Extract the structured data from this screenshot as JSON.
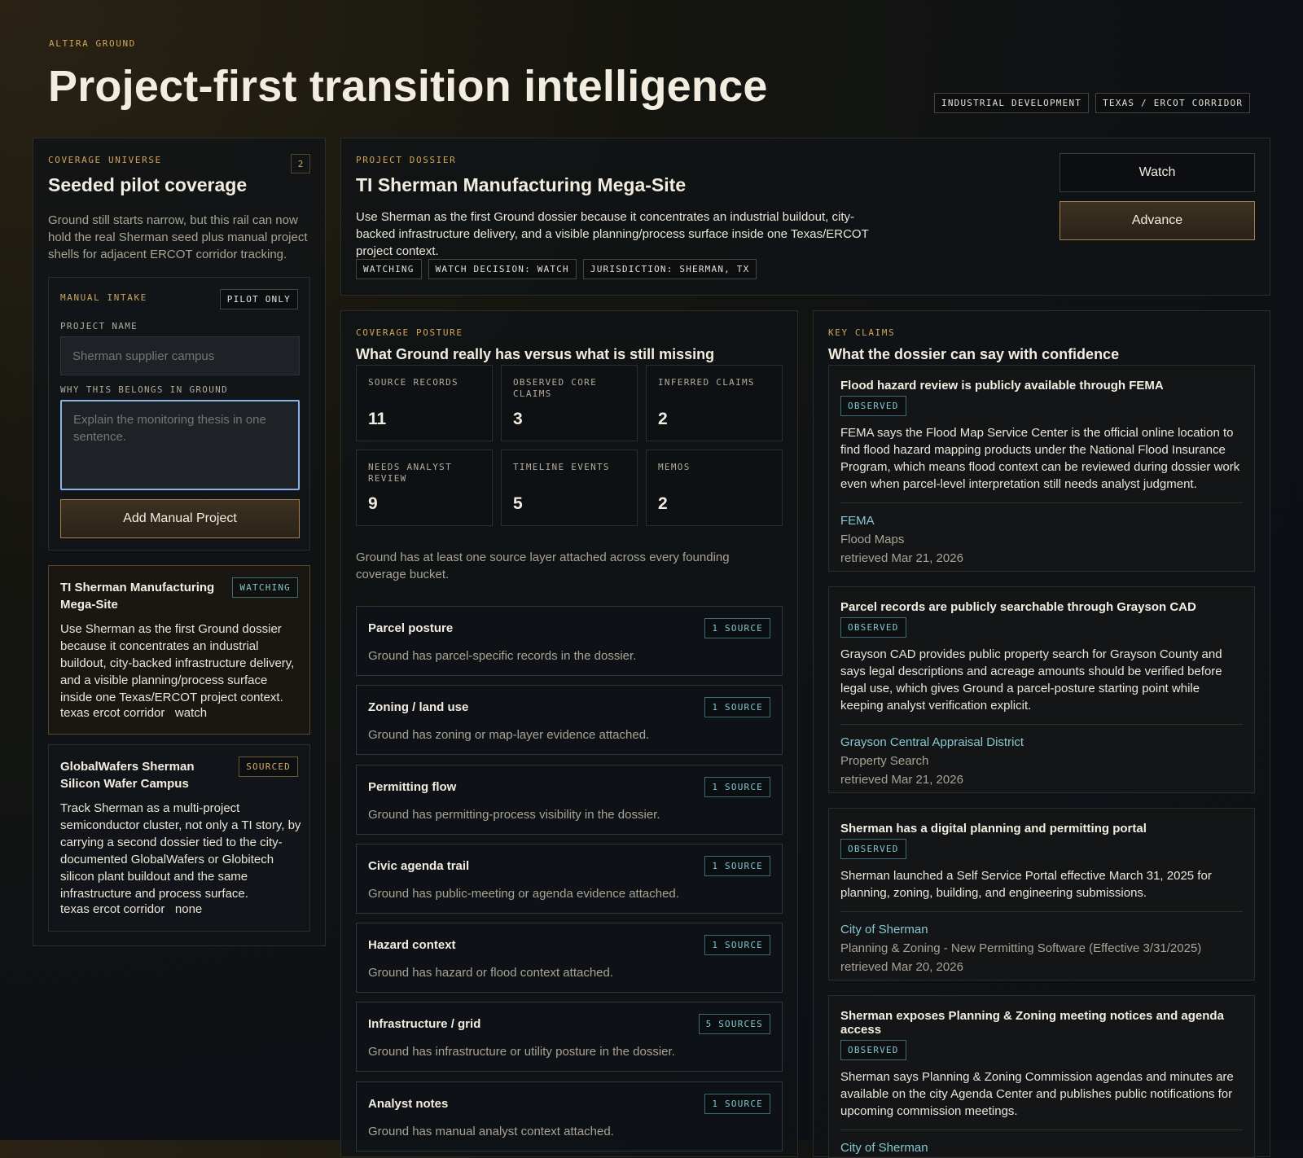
{
  "header": {
    "eyebrow": "ALTIRA GROUND",
    "title": "Project-first transition intelligence",
    "tags": [
      "INDUSTRIAL DEVELOPMENT",
      "TEXAS / ERCOT CORRIDOR"
    ]
  },
  "coverage": {
    "eyebrow": "COVERAGE UNIVERSE",
    "count": "2",
    "title": "Seeded pilot coverage",
    "description": "Ground still starts narrow, but this rail can now hold the real Sherman seed plus manual project shells for adjacent ERCOT corridor tracking.",
    "intake": {
      "eyebrow": "MANUAL INTAKE",
      "badge": "PILOT ONLY",
      "name_label": "PROJECT NAME",
      "name_placeholder": "Sherman supplier campus",
      "why_label": "WHY THIS BELONGS IN GROUND",
      "why_placeholder": "Explain the monitoring thesis in one sentence.",
      "button": "Add Manual Project"
    },
    "projects": [
      {
        "title": "TI Sherman Manufacturing Mega-Site",
        "status": "WATCHING",
        "description": "Use Sherman as the first Ground dossier because it concentrates an industrial buildout, city-backed infrastructure delivery, and a visible planning/process surface inside one Texas/ERCOT project context.",
        "corridor": "texas ercot corridor",
        "decision": "watch"
      },
      {
        "title": "GlobalWafers Sherman Silicon Wafer Campus",
        "status": "SOURCED",
        "description": "Track Sherman as a multi-project semiconductor cluster, not only a TI story, by carrying a second dossier tied to the city-documented GlobalWafers or Globitech silicon plant buildout and the same infrastructure and process surface.",
        "corridor": "texas ercot corridor",
        "decision": "none"
      }
    ]
  },
  "dossier": {
    "eyebrow": "PROJECT DOSSIER",
    "title": "TI Sherman Manufacturing Mega-Site",
    "description": "Use Sherman as the first Ground dossier because it concentrates an industrial buildout, city-backed infrastructure delivery, and a visible planning/process surface inside one Texas/ERCOT project context.",
    "tags": [
      "WATCHING",
      "WATCH DECISION: WATCH",
      "JURISDICTION: SHERMAN, TX"
    ],
    "watch_button": "Watch",
    "advance_button": "Advance"
  },
  "posture": {
    "eyebrow": "COVERAGE POSTURE",
    "title": "What Ground really has versus what is still missing",
    "stats": [
      {
        "label": "SOURCE RECORDS",
        "value": "11"
      },
      {
        "label": "OBSERVED CORE CLAIMS",
        "value": "3"
      },
      {
        "label": "INFERRED CLAIMS",
        "value": "2"
      },
      {
        "label": "NEEDS ANALYST REVIEW",
        "value": "9"
      },
      {
        "label": "TIMELINE EVENTS",
        "value": "5"
      },
      {
        "label": "MEMOS",
        "value": "2"
      }
    ],
    "summary": "Ground has at least one source layer attached across every founding coverage bucket.",
    "buckets": [
      {
        "title": "Parcel posture",
        "desc": "Ground has parcel-specific records in the dossier.",
        "sources": "1 SOURCE"
      },
      {
        "title": "Zoning / land use",
        "desc": "Ground has zoning or map-layer evidence attached.",
        "sources": "1 SOURCE"
      },
      {
        "title": "Permitting flow",
        "desc": "Ground has permitting-process visibility in the dossier.",
        "sources": "1 SOURCE"
      },
      {
        "title": "Civic agenda trail",
        "desc": "Ground has public-meeting or agenda evidence attached.",
        "sources": "1 SOURCE"
      },
      {
        "title": "Hazard context",
        "desc": "Ground has hazard or flood context attached.",
        "sources": "1 SOURCE"
      },
      {
        "title": "Infrastructure / grid",
        "desc": "Ground has infrastructure or utility posture in the dossier.",
        "sources": "5 SOURCES"
      },
      {
        "title": "Analyst notes",
        "desc": "Ground has manual analyst context attached.",
        "sources": "1 SOURCE"
      }
    ]
  },
  "claims": {
    "eyebrow": "KEY CLAIMS",
    "title": "What the dossier can say with confidence",
    "items": [
      {
        "title": "Flood hazard review is publicly available through FEMA",
        "status": "OBSERVED",
        "body": "FEMA says the Flood Map Service Center is the official online location to find flood hazard mapping products under the National Flood Insurance Program, which means flood context can be reviewed during dossier work even when parcel-level interpretation still needs analyst judgment.",
        "source": "FEMA",
        "doc": "Flood Maps",
        "retrieved": "retrieved Mar 21, 2026"
      },
      {
        "title": "Parcel records are publicly searchable through Grayson CAD",
        "status": "OBSERVED",
        "body": "Grayson CAD provides public property search for Grayson County and says legal descriptions and acreage amounts should be verified before legal use, which gives Ground a parcel-posture starting point while keeping analyst verification explicit.",
        "source": "Grayson Central Appraisal District",
        "doc": "Property Search",
        "retrieved": "retrieved Mar 21, 2026"
      },
      {
        "title": "Sherman has a digital planning and permitting portal",
        "status": "OBSERVED",
        "body": "Sherman launched a Self Service Portal effective March 31, 2025 for planning, zoning, building, and engineering submissions.",
        "source": "City of Sherman",
        "doc": "Planning & Zoning - New Permitting Software (Effective 3/31/2025)",
        "retrieved": "retrieved Mar 20, 2026"
      },
      {
        "title": "Sherman exposes Planning & Zoning meeting notices and agenda access",
        "status": "OBSERVED",
        "body": "Sherman says Planning & Zoning Commission agendas and minutes are available on the city Agenda Center and publishes public notifications for upcoming commission meetings.",
        "source": "City of Sherman",
        "doc": "",
        "retrieved": ""
      }
    ]
  },
  "colors": {
    "accent_amber": "#d0a45a",
    "accent_cyan": "#7fc6cf",
    "background": "#0d1116",
    "focus_blue": "#8ab4e6"
  }
}
